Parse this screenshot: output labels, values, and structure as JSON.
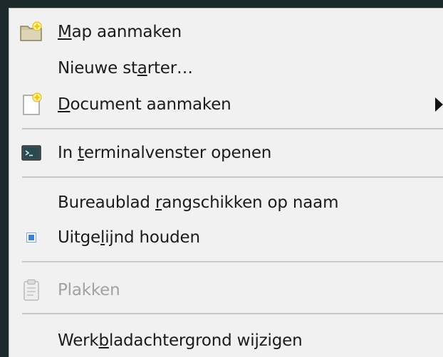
{
  "menu": {
    "items": {
      "map": {
        "pre": "",
        "acc": "M",
        "post": "ap aanmaken",
        "icon": "folder-new-icon"
      },
      "starter": {
        "pre": "Nieuwe st",
        "acc": "a",
        "post": "rter…"
      },
      "document": {
        "pre": "",
        "acc": "D",
        "post": "ocument aanmaken",
        "icon": "document-new-icon"
      },
      "terminal": {
        "pre": "In ",
        "acc": "t",
        "post": "erminalvenster openen",
        "icon": "terminal-icon"
      },
      "arrange": {
        "pre": "Bureaublad ",
        "acc": "r",
        "post": "angschikken op naam"
      },
      "aligned": {
        "pre": "Uitge",
        "acc": "l",
        "post": "ijnd houden",
        "icon": "checkbox-checked-icon"
      },
      "paste": {
        "label": "Plakken",
        "icon": "clipboard-icon",
        "disabled": true
      },
      "wallpaper": {
        "pre": "Werk",
        "acc": "b",
        "post": "ladachtergrond wijzigen"
      }
    }
  },
  "colors": {
    "menu_bg": "#f1f1f1",
    "text": "#1b1b1b",
    "disabled_text": "#a2a2a2",
    "check_blue": "#3c7fd6"
  }
}
